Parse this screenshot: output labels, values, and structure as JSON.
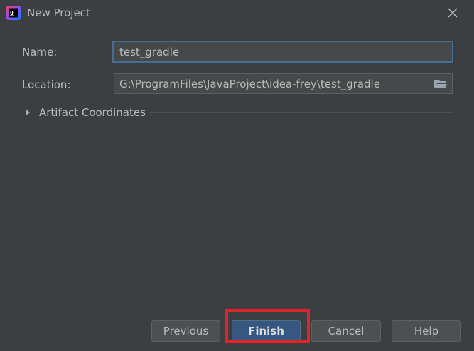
{
  "window": {
    "title": "New Project",
    "app_icon": "intellij-idea-icon",
    "close_icon": "close-icon"
  },
  "form": {
    "name_label": "Name:",
    "name_value": "test_gradle",
    "location_label": "Location:",
    "location_value": "G:\\ProgramFiles\\JavaProject\\idea-frey\\test_gradle",
    "browse_icon": "folder-icon"
  },
  "artifact": {
    "label": "Artifact Coordinates",
    "expanded": false
  },
  "buttons": {
    "previous": "Previous",
    "finish": "Finish",
    "cancel": "Cancel",
    "help": "Help"
  },
  "colors": {
    "background": "#3c3f41",
    "accent": "#365880",
    "focus_border": "#466d94",
    "highlight": "#e3232b"
  }
}
